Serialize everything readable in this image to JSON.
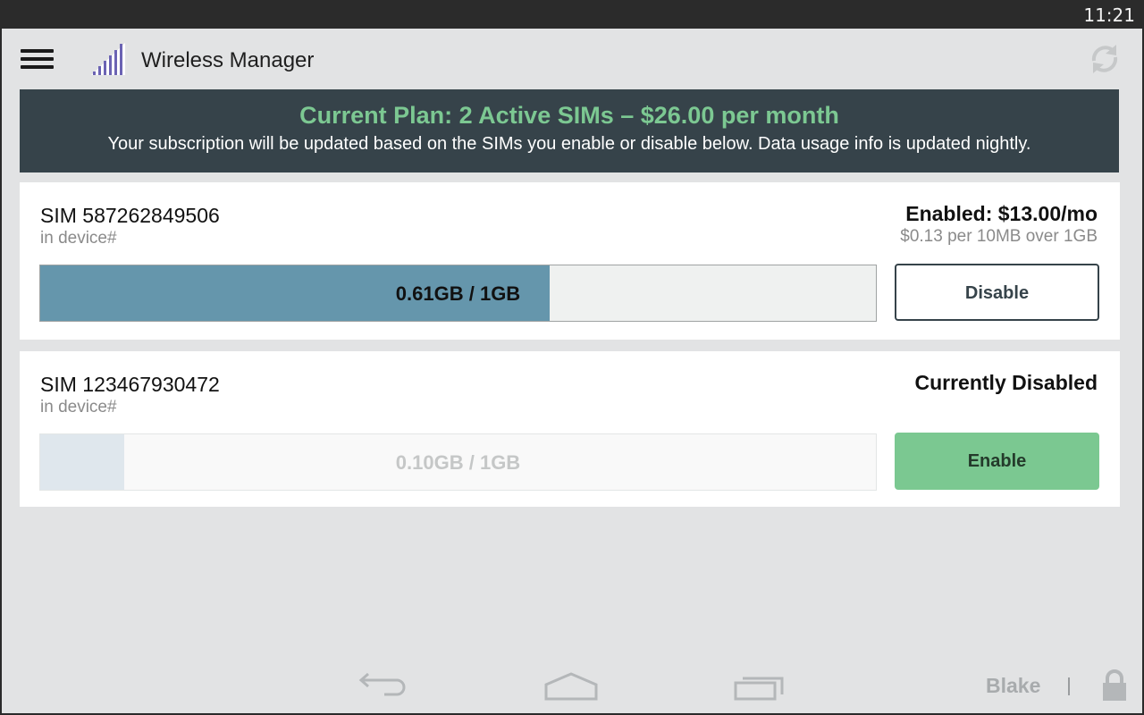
{
  "status_bar": {
    "time": "11:21"
  },
  "app": {
    "title": "Wireless Manager",
    "icons": {
      "menu": "hamburger-menu-icon",
      "logo": "signal-bars-logo",
      "refresh": "refresh-icon"
    }
  },
  "plan": {
    "title": "Current Plan: 2 Active SIMs – $26.00 per month",
    "subtitle": "Your subscription will be updated based on the SIMs you enable or disable below. Data usage info is updated nightly."
  },
  "sims": [
    {
      "id_label": "SIM 587262849506",
      "device_label": "in device#",
      "status": "Enabled: $13.00/mo",
      "rate": "$0.13 per 10MB over 1GB",
      "usage_label": "0.61GB / 1GB",
      "usage_fraction": 0.61,
      "enabled": true,
      "button_label": "Disable"
    },
    {
      "id_label": "SIM 123467930472",
      "device_label": "in device#",
      "status": "Currently Disabled",
      "rate": "",
      "usage_label": "0.10GB / 1GB",
      "usage_fraction": 0.1,
      "enabled": false,
      "button_label": "Enable"
    }
  ],
  "nav": {
    "user": "Blake",
    "icons": [
      "back-icon",
      "home-icon",
      "recent-apps-icon",
      "lock-icon"
    ]
  },
  "colors": {
    "accent_green": "#7cc892",
    "banner_bg": "#36434a",
    "usage_fill": "#6596ac",
    "disabled_fill": "#dfe7ed",
    "app_bg": "#e2e3e4"
  }
}
